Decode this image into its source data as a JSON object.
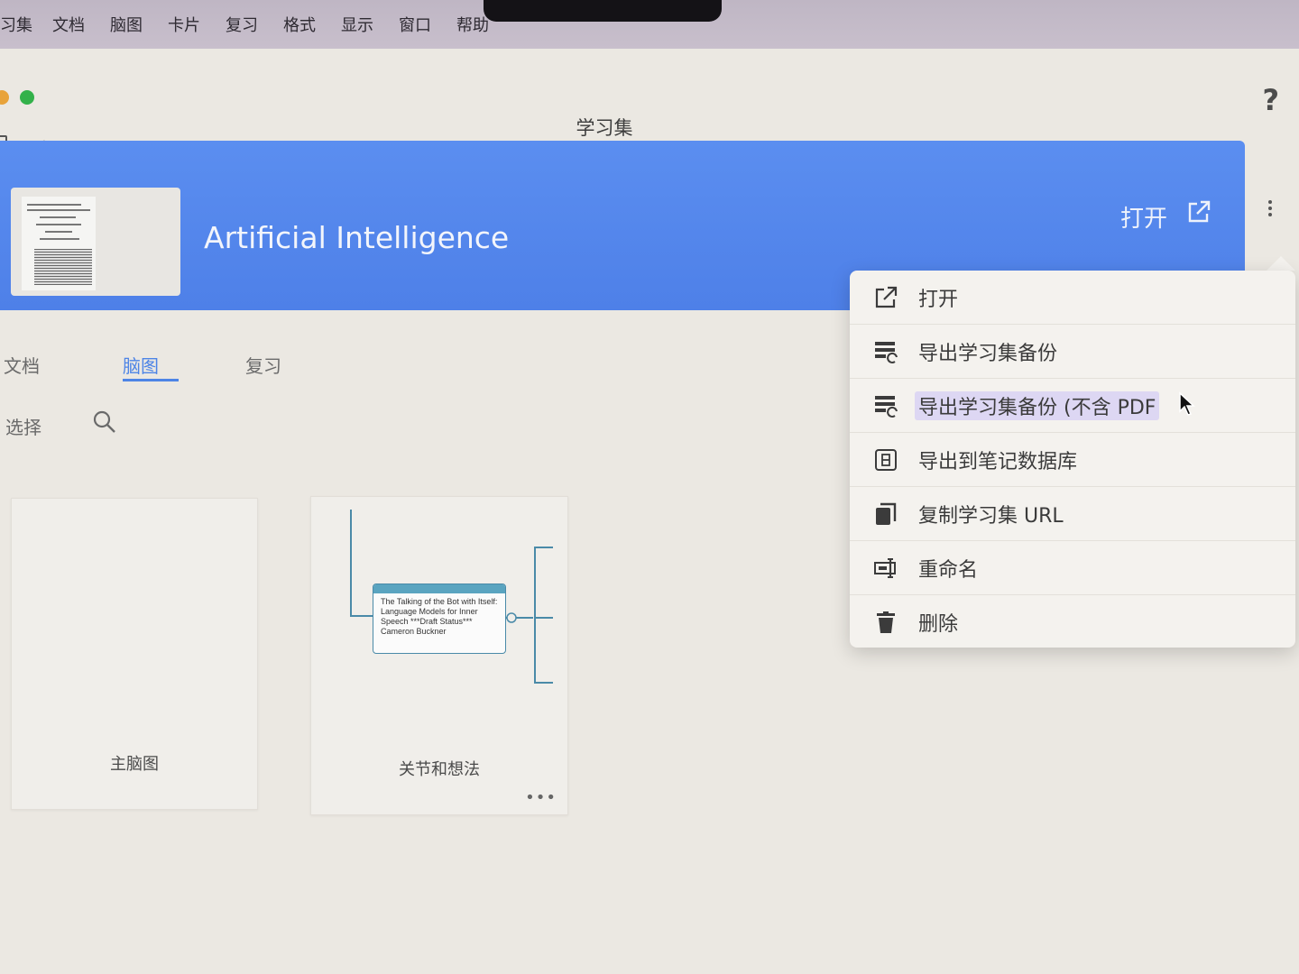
{
  "menubar": {
    "items": [
      "习集",
      "文档",
      "脑图",
      "卡片",
      "复习",
      "格式",
      "显示",
      "窗口",
      "帮助"
    ]
  },
  "window": {
    "title": "学习集",
    "help": "?"
  },
  "banner": {
    "title": "Artificial Intelligence",
    "open_label": "打开",
    "color": "#4e80e8"
  },
  "tabs": [
    {
      "label": "文档",
      "active": false
    },
    {
      "label": "脑图",
      "active": true
    },
    {
      "label": "复习",
      "active": false
    }
  ],
  "toolbar": {
    "select_label": "选择"
  },
  "cards": [
    {
      "label": "主脑图"
    },
    {
      "label": "关节和想法",
      "node_text": "The Talking of the Bot with Itself: Language Models for Inner Speech ***Draft Status*** Cameron Buckner",
      "more": "•••"
    }
  ],
  "context_menu": {
    "items": [
      {
        "label": "打开",
        "icon": "open-external-icon"
      },
      {
        "label": "导出学习集备份",
        "icon": "export-backup-icon"
      },
      {
        "label": "导出学习集备份 (不含 PDF",
        "icon": "export-backup-no-pdf-icon",
        "hover": true
      },
      {
        "label": "导出到笔记数据库",
        "icon": "export-notes-db-icon"
      },
      {
        "label": "复制学习集 URL",
        "icon": "copy-icon"
      },
      {
        "label": "重命名",
        "icon": "rename-icon"
      },
      {
        "label": "删除",
        "icon": "trash-icon"
      }
    ]
  }
}
